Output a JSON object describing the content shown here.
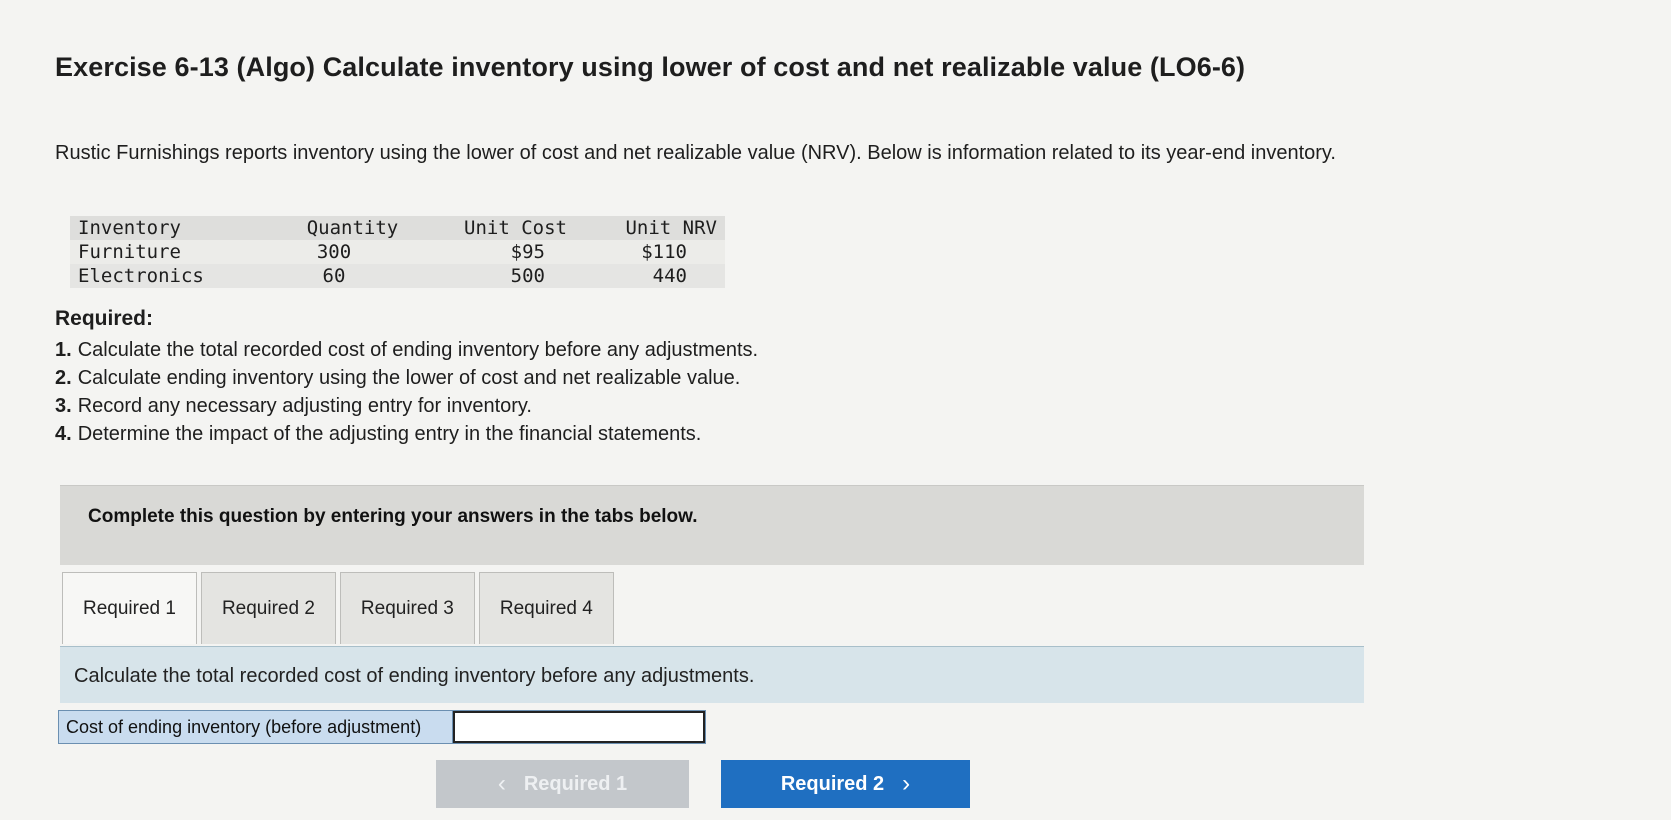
{
  "title": "Exercise 6-13 (Algo) Calculate inventory using lower of cost and net realizable value (LO6-6)",
  "intro": "Rustic Furnishings reports inventory using the lower of cost and net realizable value (NRV). Below is information related to its year-end inventory.",
  "inventory_table": {
    "headers": [
      "Inventory",
      "Quantity",
      "Unit Cost",
      "Unit NRV"
    ],
    "rows": [
      [
        "Furniture",
        "300",
        "$95",
        "$110"
      ],
      [
        "Electronics",
        "60",
        "500",
        "440"
      ]
    ]
  },
  "required": {
    "heading": "Required:",
    "items": [
      {
        "num": "1.",
        "text": "Calculate the total recorded cost of ending inventory before any adjustments."
      },
      {
        "num": "2.",
        "text": "Calculate ending inventory using the lower of cost and net realizable value."
      },
      {
        "num": "3.",
        "text": "Record any necessary adjusting entry for inventory."
      },
      {
        "num": "4.",
        "text": "Determine the impact of the adjusting entry in the financial statements."
      }
    ]
  },
  "instruction": "Complete this question by entering your answers in the tabs below.",
  "tabs": [
    {
      "label": "Required 1"
    },
    {
      "label": "Required 2"
    },
    {
      "label": "Required 3"
    },
    {
      "label": "Required 4"
    }
  ],
  "panel": {
    "prompt": "Calculate the total recorded cost of ending inventory before any adjustments.",
    "answer_label": "Cost of ending inventory (before adjustment)",
    "answer_value": ""
  },
  "nav": {
    "prev_label": "Required 1",
    "next_label": "Required 2"
  }
}
